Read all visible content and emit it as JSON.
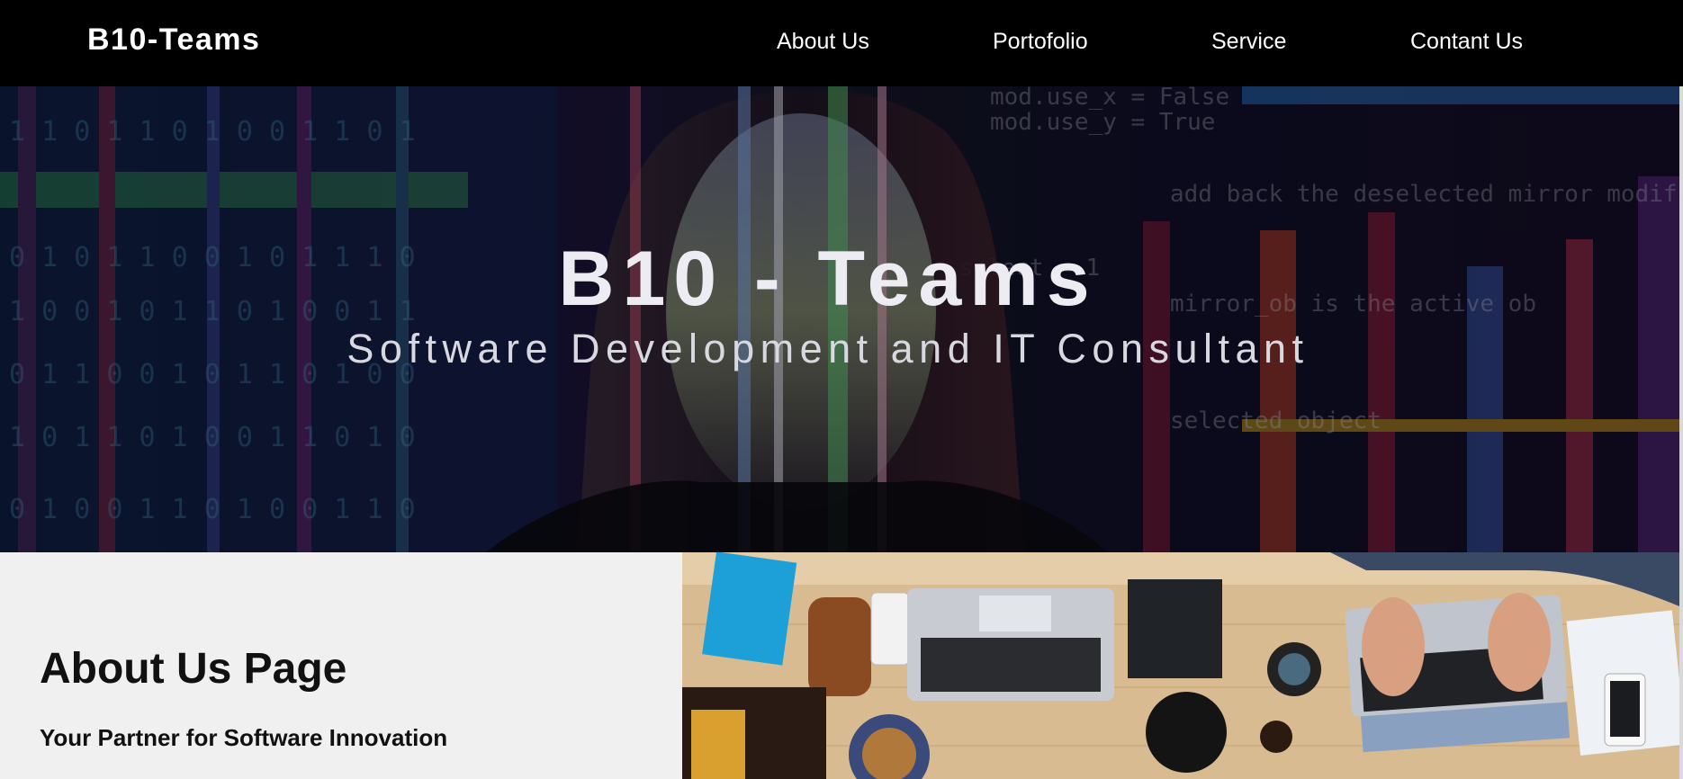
{
  "navbar": {
    "brand": "B10-Teams",
    "links": [
      {
        "label": "About Us"
      },
      {
        "label": "Portofolio"
      },
      {
        "label": "Service"
      },
      {
        "label": "Contant Us"
      }
    ]
  },
  "hero": {
    "title": "B10 - Teams",
    "subtitle": "Software Development and IT Consultant",
    "background_image": "woman-with-code-projection"
  },
  "about": {
    "title": "About Us Page",
    "tagline": "Your Partner for Software Innovation",
    "image": "desk-workspace-with-laptops"
  },
  "colors": {
    "navbar_bg": "#000000",
    "nav_text": "#ffffff",
    "about_bg": "#f0f0f0",
    "hero_text": "#ececf2"
  }
}
